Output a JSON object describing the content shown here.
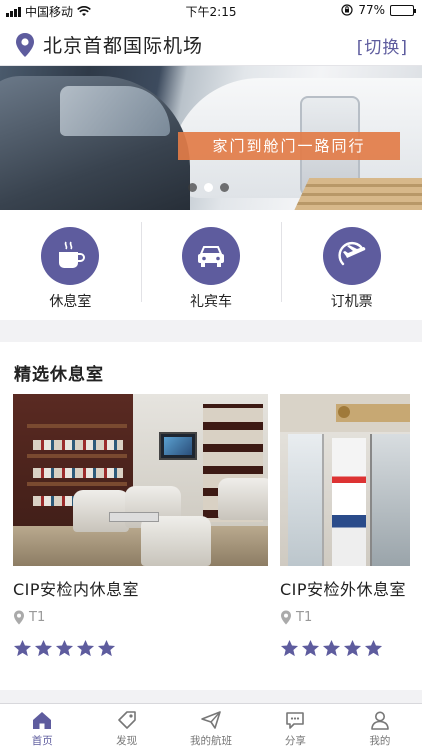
{
  "status_bar": {
    "carrier": "中国移动",
    "time": "下午2:15",
    "battery_percent": "77%",
    "battery_level": 0.77
  },
  "header": {
    "airport": "北京首都国际机场",
    "switch_label": "[切换]"
  },
  "banner": {
    "slogan": "家门到舱门一路同行",
    "slide_count": 3,
    "active_slide": 2
  },
  "quick_menu": [
    {
      "label": "休息室",
      "icon": "coffee-cup-icon"
    },
    {
      "label": "礼宾车",
      "icon": "car-icon"
    },
    {
      "label": "订机票",
      "icon": "plane-takeoff-icon"
    }
  ],
  "lounges": {
    "title": "精选休息室",
    "items": [
      {
        "name": "CIP安检内休息室",
        "terminal": "T1",
        "rating": 5
      },
      {
        "name": "CIP安检外休息室",
        "terminal": "T1",
        "rating": 5
      }
    ]
  },
  "tab_bar": {
    "items": [
      {
        "label": "首页",
        "icon": "home-icon",
        "active": true
      },
      {
        "label": "发现",
        "icon": "tag-icon",
        "active": false
      },
      {
        "label": "我的航班",
        "icon": "paper-plane-icon",
        "active": false
      },
      {
        "label": "分享",
        "icon": "chat-bubble-icon",
        "active": false
      },
      {
        "label": "我的",
        "icon": "user-icon",
        "active": false
      }
    ]
  },
  "colors": {
    "accent": "#5e5c9e",
    "slogan_bg": "#e27c48",
    "star": "#5e5c9e"
  }
}
